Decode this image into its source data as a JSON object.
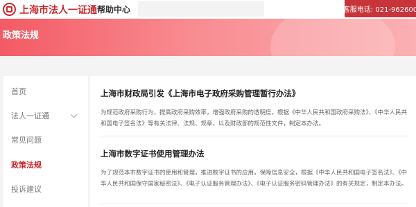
{
  "header": {
    "logo_text": "上海市法人一证通",
    "help_center": "帮助中心",
    "search_placeholder": "",
    "hotline": "客服电话: 021-962600"
  },
  "banner": {
    "title": "政策法规"
  },
  "sidebar": {
    "items": [
      {
        "label": "首页",
        "active": false
      },
      {
        "label": "法人一证通",
        "active": false,
        "expandable": true
      },
      {
        "label": "常见问题",
        "active": false
      },
      {
        "label": "政策法规",
        "active": true
      },
      {
        "label": "投诉建议",
        "active": false
      }
    ]
  },
  "articles": [
    {
      "title": "上海市财政局引发《上海市电子政府采购管理暂行办法》",
      "summary": "为规范政府采购行为，提高政府采购效率，增强政府采购的透明度，根据《中华人民共和国政府采购法》、《中华人民共和国电子签名法》等有关法律、法规、规章，以及财政部的规范性文件，制定本办法。"
    },
    {
      "title": "上海市数字证书使用管理办法",
      "summary": "为了规范本市数字证书的使用和管理，推进数字证书的应用，保障信息安全，根据《中华人民共和国电子签名法》、《中华人民共和国保守国家秘密法》、《电子认证服务管理办法》、《电子认证服务密码管理办法》的有关规定，制定本办法。"
    }
  ],
  "colors": {
    "brand_red": "#c8282e",
    "hotline_bg": "#c8343a",
    "banner_start": "#f35a64",
    "banner_end": "#fbb0b3"
  }
}
